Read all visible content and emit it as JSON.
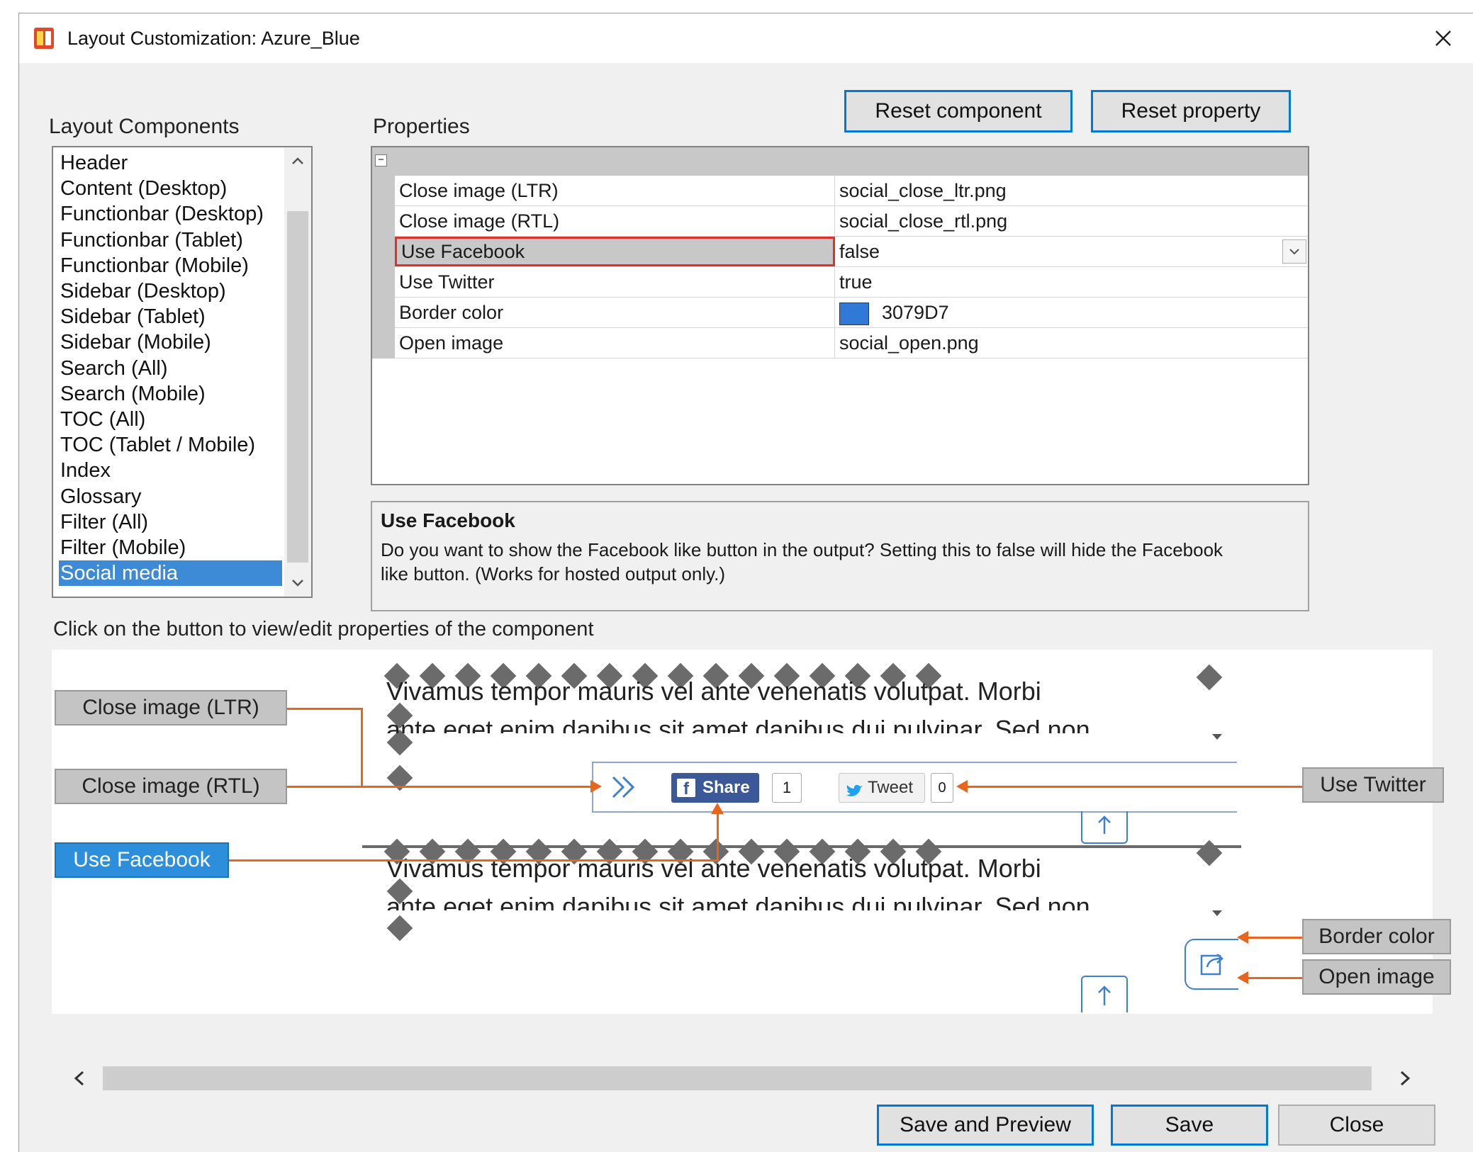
{
  "window": {
    "title": "Layout Customization: Azure_Blue"
  },
  "labels": {
    "layout_components": "Layout Components",
    "properties": "Properties",
    "hint": "Click on the button to view/edit properties of the component"
  },
  "buttons": {
    "reset_component": "Reset component",
    "reset_property": "Reset property",
    "save_and_preview": "Save and Preview",
    "save": "Save",
    "close": "Close"
  },
  "components": [
    "Header",
    "Content (Desktop)",
    "Functionbar (Desktop)",
    "Functionbar (Tablet)",
    "Functionbar (Mobile)",
    "Sidebar (Desktop)",
    "Sidebar (Tablet)",
    "Sidebar (Mobile)",
    "Search (All)",
    "Search (Mobile)",
    "TOC (All)",
    "TOC (Tablet / Mobile)",
    "Index",
    "Glossary",
    "Filter (All)",
    "Filter (Mobile)",
    "Social media"
  ],
  "selected_component": "Social media",
  "properties": [
    {
      "name": "Close image (LTR)",
      "value": "social_close_ltr.png"
    },
    {
      "name": "Close image (RTL)",
      "value": "social_close_rtl.png"
    },
    {
      "name": "Use Facebook",
      "value": "false"
    },
    {
      "name": "Use Twitter",
      "value": "true"
    },
    {
      "name": "Border color",
      "value": "3079D7"
    },
    {
      "name": "Open image",
      "value": "social_open.png"
    }
  ],
  "description": {
    "title": "Use Facebook",
    "text_line1": "Do you want to show the Facebook like button in the output? Setting this to false will hide the Facebook",
    "text_line2": "like button. (Works for hosted output only.)"
  },
  "preview": {
    "lorem_line1": "Vivamus tempor mauris vel ante venenatis volutpat. Morbi",
    "lorem_line2": "ante eget enim dapibus sit amet dapibus dui pulvinar. Sed non",
    "share_label": "Share",
    "share_count": "1",
    "tweet_label": "Tweet",
    "tweet_count": "0",
    "buttons": {
      "close_ltr": "Close image (LTR)",
      "close_rtl": "Close image (RTL)",
      "use_facebook": "Use Facebook",
      "use_twitter": "Use Twitter",
      "border_color": "Border color",
      "open_image": "Open image"
    }
  },
  "colors": {
    "border_color_swatch": "#3079D7",
    "selection": "#3D8AD6",
    "annotation": "#E8651E",
    "highlight": "#D9312B"
  }
}
